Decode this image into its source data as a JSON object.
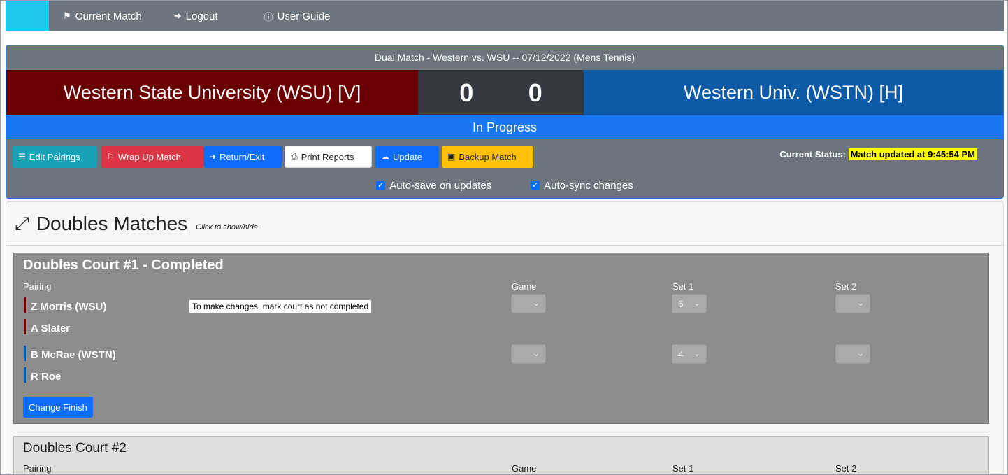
{
  "nav": {
    "items": [
      {
        "label": "Current Match",
        "icon": "podium-icon"
      },
      {
        "label": "Logout",
        "icon": "logout-icon"
      },
      {
        "label": "User Guide",
        "icon": "info-icon"
      }
    ]
  },
  "match": {
    "title": "Dual Match - Western vs. WSU -- 07/12/2022 (Mens Tennis)",
    "left_team": "Western State University (WSU) [V]",
    "right_team": "Western Univ. (WSTN) [H]",
    "left_score": "0",
    "right_score": "0",
    "status": "In Progress",
    "colors": {
      "left": "#6b0000",
      "right": "#0d5aa7",
      "status": "#1877f2"
    }
  },
  "toolbar": {
    "edit_pairings": "Edit Pairings",
    "wrap_up": "Wrap Up Match",
    "return_exit": "Return/Exit",
    "print_reports": "Print Reports",
    "update": "Update",
    "backup": "Backup Match",
    "current_status_label": "Current Status:",
    "current_status_value": "Match updated at 9:45:54 PM",
    "auto_save": "Auto-save on updates",
    "auto_sync": "Auto-sync changes"
  },
  "doubles": {
    "section_title": "Doubles Matches",
    "hint": "Click to show/hide",
    "court1": {
      "title": "Doubles Court #1 - Completed",
      "col_pairing": "Pairing",
      "col_game": "Game",
      "col_set1": "Set 1",
      "col_set2": "Set 2",
      "team1_player1": "Z Morris (WSU)",
      "team1_player2": "A Slater",
      "team2_player1": "B McRae (WSTN)",
      "team2_player2": "R Roe",
      "tooltip": "To make changes, mark court as not completed",
      "team1_set1": "6",
      "team2_set1": "4",
      "change_finish": "Change Finish"
    },
    "court2": {
      "title": "Doubles Court #2",
      "col_pairing": "Pairing",
      "col_game": "Game",
      "col_set1": "Set 1",
      "col_set2": "Set 2"
    }
  }
}
